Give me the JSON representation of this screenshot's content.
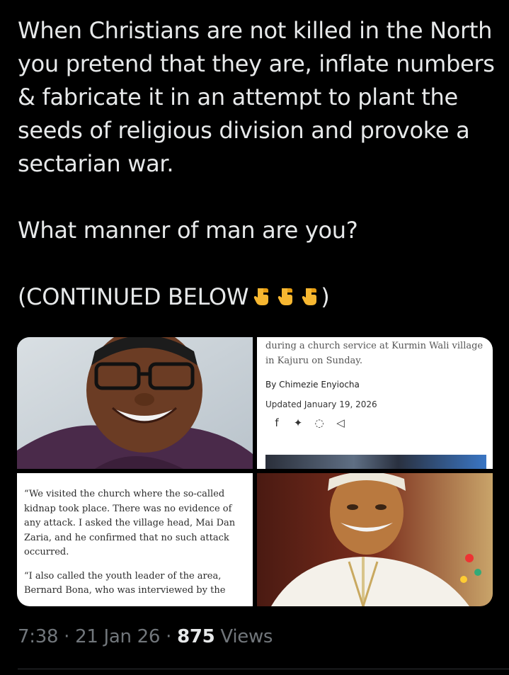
{
  "tweet": {
    "lines": [
      "When Christians are not killed in the North you pretend that they are, inflate numbers & fabricate it in an attempt to plant the seeds of religious division and provoke a sectarian war.",
      "What manner of man are you?",
      "(CONTINUED BELOW"
    ],
    "emoji_icons": [
      "pointing-down-icon",
      "pointing-down-icon",
      "pointing-down-icon"
    ],
    "closing": ")"
  },
  "media": {
    "article_snippet": "during a church service at Kurmin Wali village in Kajuru on Sunday.",
    "byline": "By Chimezie Enyiocha",
    "updated": "Updated January 19, 2026",
    "share_icons": [
      "facebook-icon",
      "twitter-icon",
      "whatsapp-icon",
      "send-icon"
    ],
    "quote_para_1": "“We visited the church where the so-called kidnap took place. There was no evidence of any attack. I asked the village head, Mai Dan Zaria, and he confirmed that no such attack occurred.",
    "quote_para_2": "“I also called the youth leader of the area, Bernard Bona, who was interviewed by the"
  },
  "meta": {
    "time": "7:38",
    "sep": "·",
    "date": "21 Jan 26",
    "views_count": "875",
    "views_label": "Views"
  },
  "colors": {
    "background": "#000000",
    "text": "#e7e9ea",
    "secondary": "#71767b"
  }
}
